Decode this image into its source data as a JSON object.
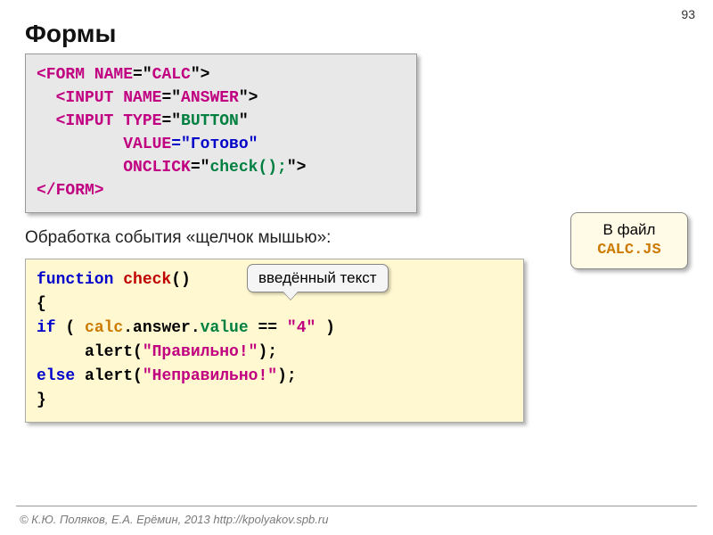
{
  "page_number": "93",
  "title": "Формы",
  "footer": "© К.Ю. Поляков, Е.А. Ерёмин, 2013    http://kpolyakov.spb.ru",
  "caption": "Обработка события «щелчок мышью»:",
  "balloon": {
    "line1": "В файл",
    "line2": "CALC.JS"
  },
  "tooltip": "введённый текст",
  "code1": {
    "l1a": "<FORM NAME",
    "l1b": "=\"",
    "l1c": "CALC",
    "l1d": "\">",
    "l2a": "  <INPUT NAME",
    "l2b": "=\"",
    "l2c": "ANSWER",
    "l2d": "\">",
    "l3a": "  <INPUT TYPE",
    "l3b": "=\"",
    "l3c": "BUTTON",
    "l3d": "\"",
    "l4a": "         VALUE",
    "l4b": "=\"Готово\"",
    "l5a": "         ONCLICK",
    "l5b": "=\"",
    "l5c": "check();",
    "l5d": "\">",
    "l6": "</FORM>"
  },
  "code2": {
    "l1a": "function",
    "l1b": " check",
    "l1c": "()",
    "l2": "{",
    "l3a": "if",
    "l3b": " ( ",
    "l3c": "calc",
    "l3d": ".answer.",
    "l3e": "value",
    "l3f": " == ",
    "l3g": "\"4\"",
    "l3h": " )",
    "l4a": "     alert(",
    "l4b": "\"Правильно!\"",
    "l4c": ");",
    "l5a": "else",
    "l5b": " alert(",
    "l5c": "\"Неправильно!\"",
    "l5d": ");",
    "l6": "}"
  }
}
